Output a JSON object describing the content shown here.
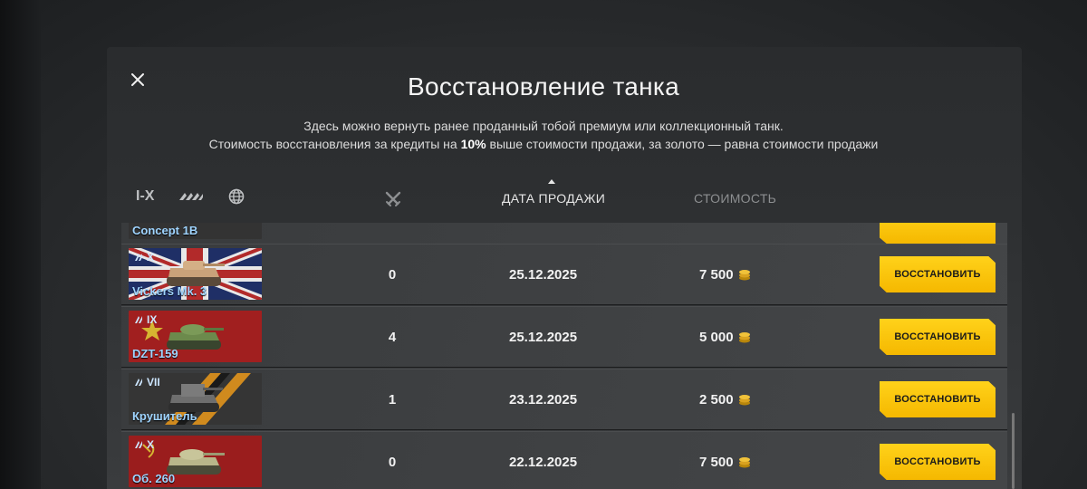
{
  "dialog": {
    "title": "Восстановление танка",
    "subtitle_line1": "Здесь можно вернуть ранее проданный тобой премиум или коллекционный танк.",
    "subtitle_line2_pre": "Стоимость восстановления за кредиты на ",
    "subtitle_line2_bold": "10%",
    "subtitle_line2_post": " выше стоимости продажи, за золото — равна стоимости продажи"
  },
  "filters": {
    "tier_label": "I-X",
    "type_icon": "vehicle-type-icon",
    "nation_icon": "globe-icon"
  },
  "columns": {
    "battles_icon": "crossed-swords-icon",
    "sale_date": "ДАТА ПРОДАЖИ",
    "cost": "СТОИМОСТЬ"
  },
  "rows": [
    {
      "name": "Concept 1B",
      "tier": "",
      "battles": "",
      "date": "",
      "price": "",
      "button": ""
    },
    {
      "name": "Vickers Mk. 3",
      "tier": "X",
      "battles": "0",
      "date": "25.12.2025",
      "price": "7 500",
      "button": "ВОССТАНОВИТЬ"
    },
    {
      "name": "DZT-159",
      "tier": "IX",
      "battles": "4",
      "date": "25.12.2025",
      "price": "5 000",
      "button": "ВОССТАНОВИТЬ"
    },
    {
      "name": "Крушитель",
      "tier": "VII",
      "battles": "1",
      "date": "23.12.2025",
      "price": "2 500",
      "button": "ВОССТАНОВИТЬ"
    },
    {
      "name": "Об. 260",
      "tier": "X",
      "battles": "0",
      "date": "22.12.2025",
      "price": "7 500",
      "button": "ВОССТАНОВИТЬ"
    }
  ],
  "colors": {
    "accent_button": "#f5b800",
    "tank_name": "#9fd4ff",
    "gold_coin": "#e9b42a"
  }
}
